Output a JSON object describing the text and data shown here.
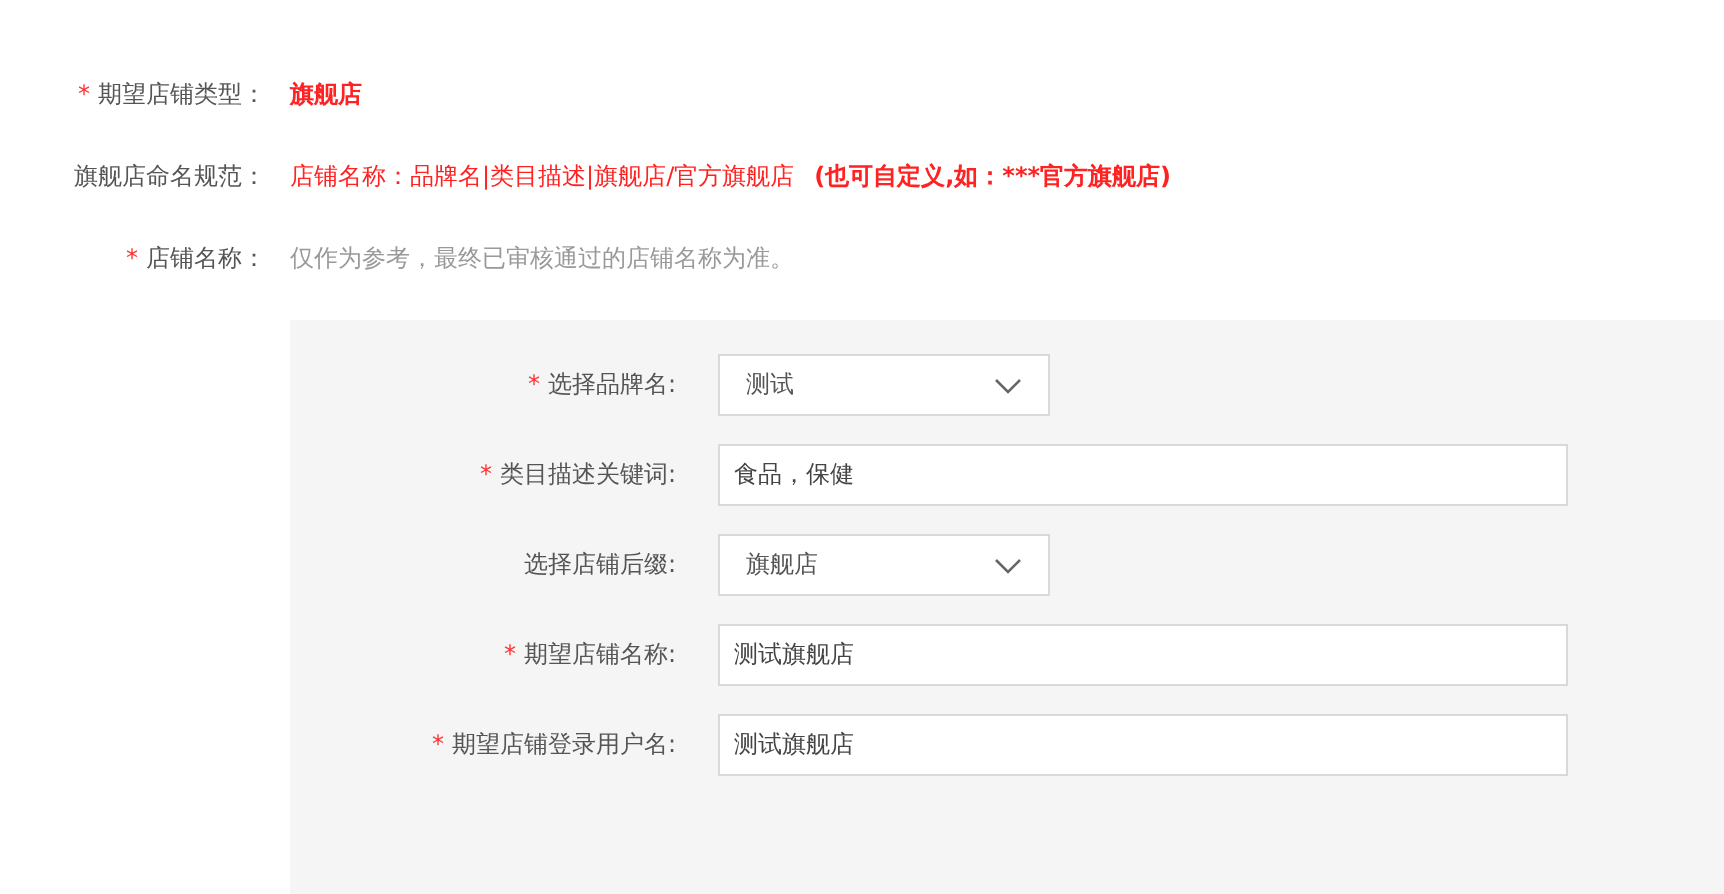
{
  "info_rows": [
    {
      "required_mark": "*",
      "label": "期望店铺类型：",
      "value": "旗舰店",
      "kind": "highlight"
    },
    {
      "label": "旗舰店命名规范：",
      "value": "店铺名称：品牌名|类目描述|旗舰店/官方旗舰店",
      "note": "(也可自定义,如：***官方旗舰店)",
      "kind": "rule"
    },
    {
      "required_mark": "*",
      "label": "店铺名称：",
      "value": "仅作为参考，最终已审核通过的店铺名称为准。",
      "kind": "hint"
    }
  ],
  "form_fields": [
    {
      "required_mark": "*",
      "label": "选择品牌名:",
      "kind": "select",
      "value": "测试"
    },
    {
      "required_mark": "*",
      "label": "类目描述关键词:",
      "kind": "input",
      "value": "食品，保健"
    },
    {
      "label": "选择店铺后缀:",
      "kind": "select",
      "value": "旗舰店"
    },
    {
      "required_mark": "*",
      "label": "期望店铺名称:",
      "kind": "input",
      "value": "测试旗舰店"
    },
    {
      "required_mark": "*",
      "label": "期望店铺登录用户名:",
      "kind": "input",
      "value": "测试旗舰店"
    }
  ]
}
